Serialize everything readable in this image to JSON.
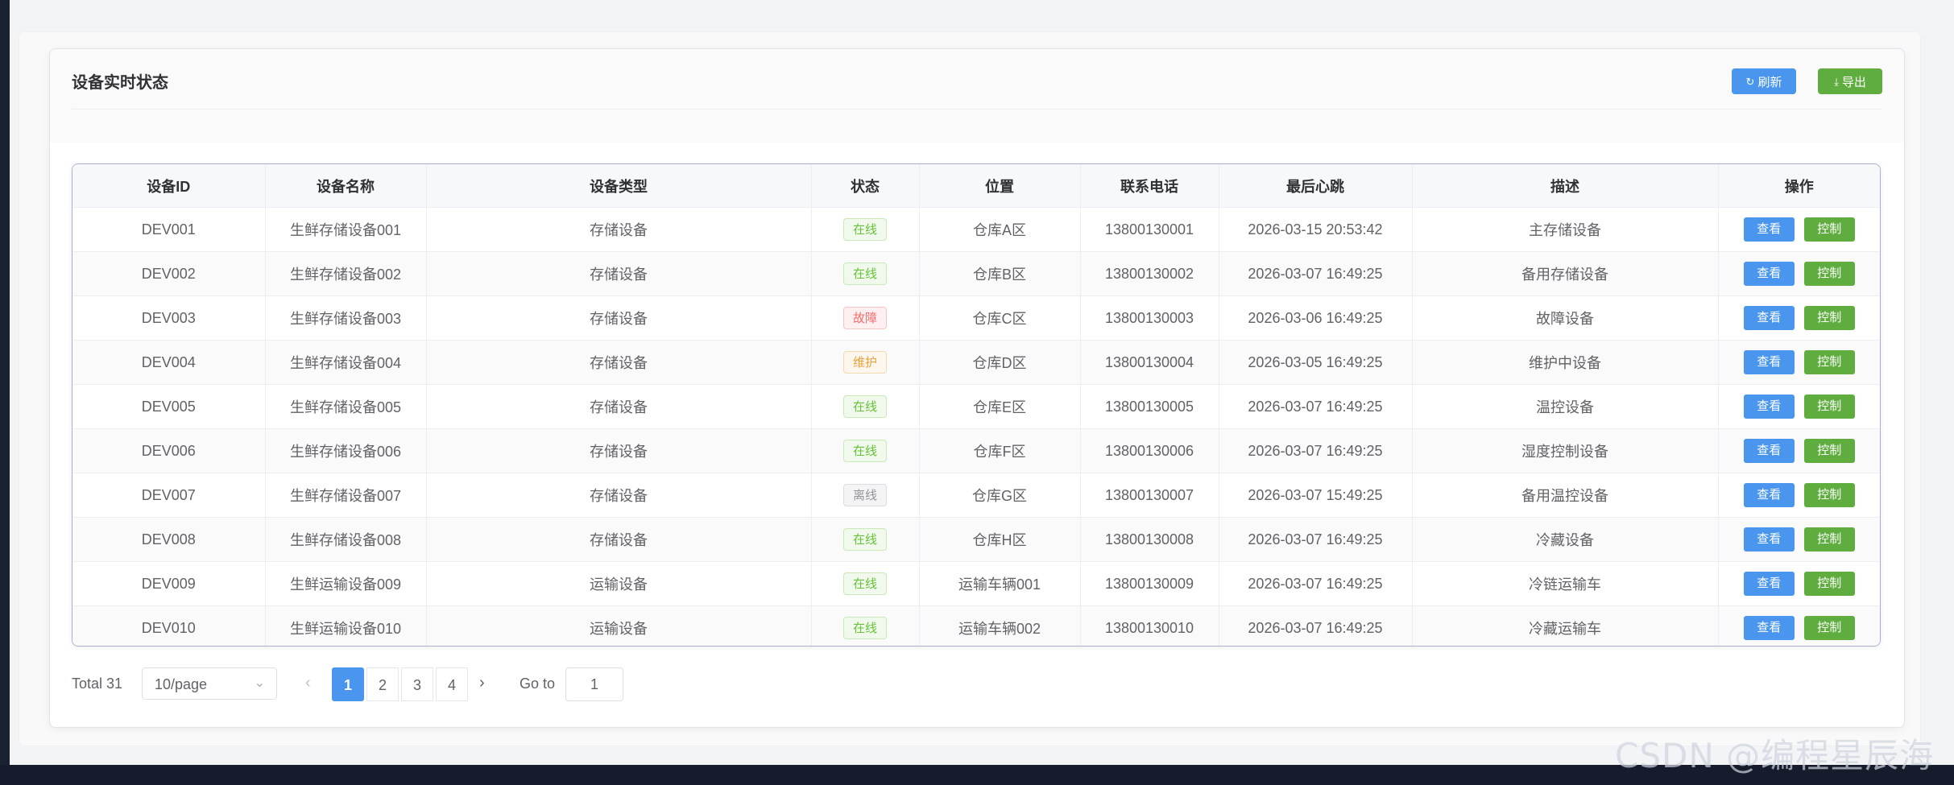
{
  "card": {
    "title": "设备实时状态"
  },
  "toolbar": {
    "refresh_label": "刷新",
    "export_label": "导出"
  },
  "table": {
    "columns": [
      "设备ID",
      "设备名称",
      "设备类型",
      "状态",
      "位置",
      "联系电话",
      "最后心跳",
      "描述",
      "操作"
    ],
    "rows": [
      {
        "id": "DEV001",
        "name": "生鲜存储设备001",
        "type": "存储设备",
        "status": "在线",
        "status_kind": "online",
        "location": "仓库A区",
        "phone": "13800130001",
        "heartbeat": "2026-03-15 20:53:42",
        "desc": "主存储设备"
      },
      {
        "id": "DEV002",
        "name": "生鲜存储设备002",
        "type": "存储设备",
        "status": "在线",
        "status_kind": "online",
        "location": "仓库B区",
        "phone": "13800130002",
        "heartbeat": "2026-03-07 16:49:25",
        "desc": "备用存储设备"
      },
      {
        "id": "DEV003",
        "name": "生鲜存储设备003",
        "type": "存储设备",
        "status": "故障",
        "status_kind": "fault",
        "location": "仓库C区",
        "phone": "13800130003",
        "heartbeat": "2026-03-06 16:49:25",
        "desc": "故障设备"
      },
      {
        "id": "DEV004",
        "name": "生鲜存储设备004",
        "type": "存储设备",
        "status": "维护",
        "status_kind": "maint",
        "location": "仓库D区",
        "phone": "13800130004",
        "heartbeat": "2026-03-05 16:49:25",
        "desc": "维护中设备"
      },
      {
        "id": "DEV005",
        "name": "生鲜存储设备005",
        "type": "存储设备",
        "status": "在线",
        "status_kind": "online",
        "location": "仓库E区",
        "phone": "13800130005",
        "heartbeat": "2026-03-07 16:49:25",
        "desc": "温控设备"
      },
      {
        "id": "DEV006",
        "name": "生鲜存储设备006",
        "type": "存储设备",
        "status": "在线",
        "status_kind": "online",
        "location": "仓库F区",
        "phone": "13800130006",
        "heartbeat": "2026-03-07 16:49:25",
        "desc": "湿度控制设备"
      },
      {
        "id": "DEV007",
        "name": "生鲜存储设备007",
        "type": "存储设备",
        "status": "离线",
        "status_kind": "offline",
        "location": "仓库G区",
        "phone": "13800130007",
        "heartbeat": "2026-03-07 15:49:25",
        "desc": "备用温控设备"
      },
      {
        "id": "DEV008",
        "name": "生鲜存储设备008",
        "type": "存储设备",
        "status": "在线",
        "status_kind": "online",
        "location": "仓库H区",
        "phone": "13800130008",
        "heartbeat": "2026-03-07 16:49:25",
        "desc": "冷藏设备"
      },
      {
        "id": "DEV009",
        "name": "生鲜运输设备009",
        "type": "运输设备",
        "status": "在线",
        "status_kind": "online",
        "location": "运输车辆001",
        "phone": "13800130009",
        "heartbeat": "2026-03-07 16:49:25",
        "desc": "冷链运输车"
      },
      {
        "id": "DEV010",
        "name": "生鲜运输设备010",
        "type": "运输设备",
        "status": "在线",
        "status_kind": "online",
        "location": "运输车辆002",
        "phone": "13800130010",
        "heartbeat": "2026-03-07 16:49:25",
        "desc": "冷藏运输车"
      }
    ],
    "actions": {
      "view_label": "查看",
      "control_label": "控制"
    }
  },
  "pagination": {
    "total_label": "Total 31",
    "page_size": "10/page",
    "pages": [
      "1",
      "2",
      "3",
      "4"
    ],
    "current_page": "1",
    "goto_label": "Go to",
    "goto_value": "1"
  },
  "watermark": "CSDN @编程星辰海",
  "colors": {
    "primary": "#4a95ee",
    "success": "#5fad3f",
    "tag_online": "#67c23a",
    "tag_fault": "#f56c6c",
    "tag_maint": "#e6a23c",
    "tag_offline": "#909399"
  },
  "icons": {
    "refresh": "refresh-icon",
    "export": "download-icon"
  }
}
